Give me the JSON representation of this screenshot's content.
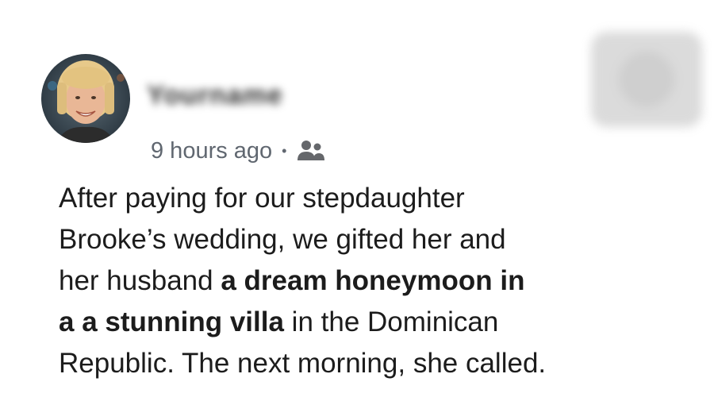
{
  "post": {
    "author_name": "Yourname",
    "timestamp": "9 hours ago",
    "separator": "•",
    "audience_icon": "friends-icon",
    "lines": [
      {
        "parts": [
          {
            "text": "After paying for our stepdaughter",
            "bold": false
          }
        ]
      },
      {
        "parts": [
          {
            "text": "Brooke’s wedding, we gifted her and",
            "bold": false
          }
        ]
      },
      {
        "parts": [
          {
            "text": "her husband ",
            "bold": false
          },
          {
            "text": "a dream honeymoon in",
            "bold": true
          }
        ]
      },
      {
        "parts": [
          {
            "text": "a a stunning villa",
            "bold": true
          },
          {
            "text": " in the Dominican",
            "bold": false
          }
        ]
      },
      {
        "parts": [
          {
            "text": "Republic. The next morning, she called.",
            "bold": false
          }
        ]
      }
    ]
  }
}
